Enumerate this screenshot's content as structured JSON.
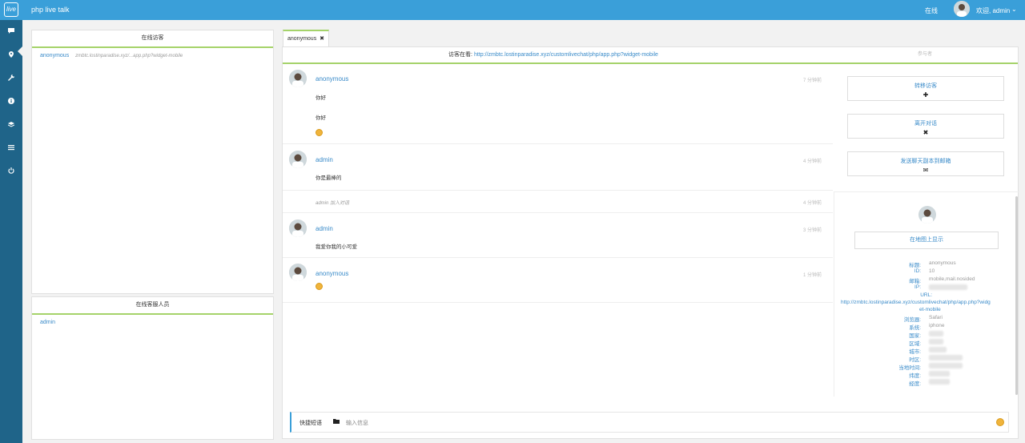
{
  "topbar": {
    "logo_text": "live",
    "app_title": "php live talk",
    "status": "在线",
    "welcome": "欢迎, admin",
    "chevron": "⌄"
  },
  "sidebar": {
    "icons": [
      "chat-icon",
      "location-icon",
      "wrench-icon",
      "info-icon",
      "layers-icon",
      "list-icon",
      "power-icon"
    ]
  },
  "online_visitors": {
    "title": "在线访客",
    "items": [
      {
        "name": "anonymous",
        "url": "zmbtc.lostinparadise.xyz/...app.php?widget-mobile"
      }
    ]
  },
  "online_staff": {
    "title": "在线客服人员",
    "items": [
      {
        "name": "admin"
      }
    ]
  },
  "tab": {
    "label": "anonymous",
    "close": "✖"
  },
  "visiting": {
    "label": "访客在看:",
    "url": "http://zmbtc.lostinparadise.xyz/customlivechat/php/app.php?widget-mobile",
    "participants": "参与者"
  },
  "messages": [
    {
      "name": "anonymous",
      "time": "7 分钟前",
      "lines": [
        "你好",
        "你好"
      ],
      "emoji": true
    },
    {
      "name": "admin",
      "time": "4 分钟前",
      "lines": [
        "你是最棒的"
      ],
      "emoji": false
    },
    {
      "system": "admin 加入对话",
      "time": "4 分钟前"
    },
    {
      "name": "admin",
      "time": "3 分钟前",
      "lines": [
        "我爱你我的小可爱"
      ],
      "emoji": false
    },
    {
      "name": "anonymous",
      "time": "1 分钟前",
      "lines": [],
      "emoji": true
    }
  ],
  "actions": [
    {
      "label": "转移访客",
      "icon": "✚"
    },
    {
      "label": "离开对话",
      "icon": "✖"
    },
    {
      "label": "发送聊天副本到邮箱",
      "icon": "✉"
    }
  ],
  "visitor_info": {
    "map_button": "在地图上显示",
    "rows": [
      {
        "label": "标题:",
        "value": "anonymous"
      },
      {
        "label": "ID:",
        "value": "10"
      },
      {
        "label": "邮箱:",
        "value": "mobile,mail.nosided"
      },
      {
        "label": "IP:",
        "value": ""
      },
      {
        "label": "URL:",
        "value": ""
      },
      {
        "label": "浏览器:",
        "value": "Safari"
      },
      {
        "label": "系统:",
        "value": "iphone"
      },
      {
        "label": "国家:",
        "value": ""
      },
      {
        "label": "区域:",
        "value": ""
      },
      {
        "label": "城市:",
        "value": ""
      },
      {
        "label": "时区:",
        "value": ""
      },
      {
        "label": "当地时间:",
        "value": ""
      },
      {
        "label": "纬度:",
        "value": ""
      },
      {
        "label": "经度:",
        "value": ""
      }
    ],
    "url_full": "http://zmbtc.lostinparadise.xyz/customlivechat/php/app.php?widg",
    "url_tail": "et-mobile"
  },
  "composer": {
    "quick_reply": "快捷短语",
    "placeholder": "输入信息"
  }
}
